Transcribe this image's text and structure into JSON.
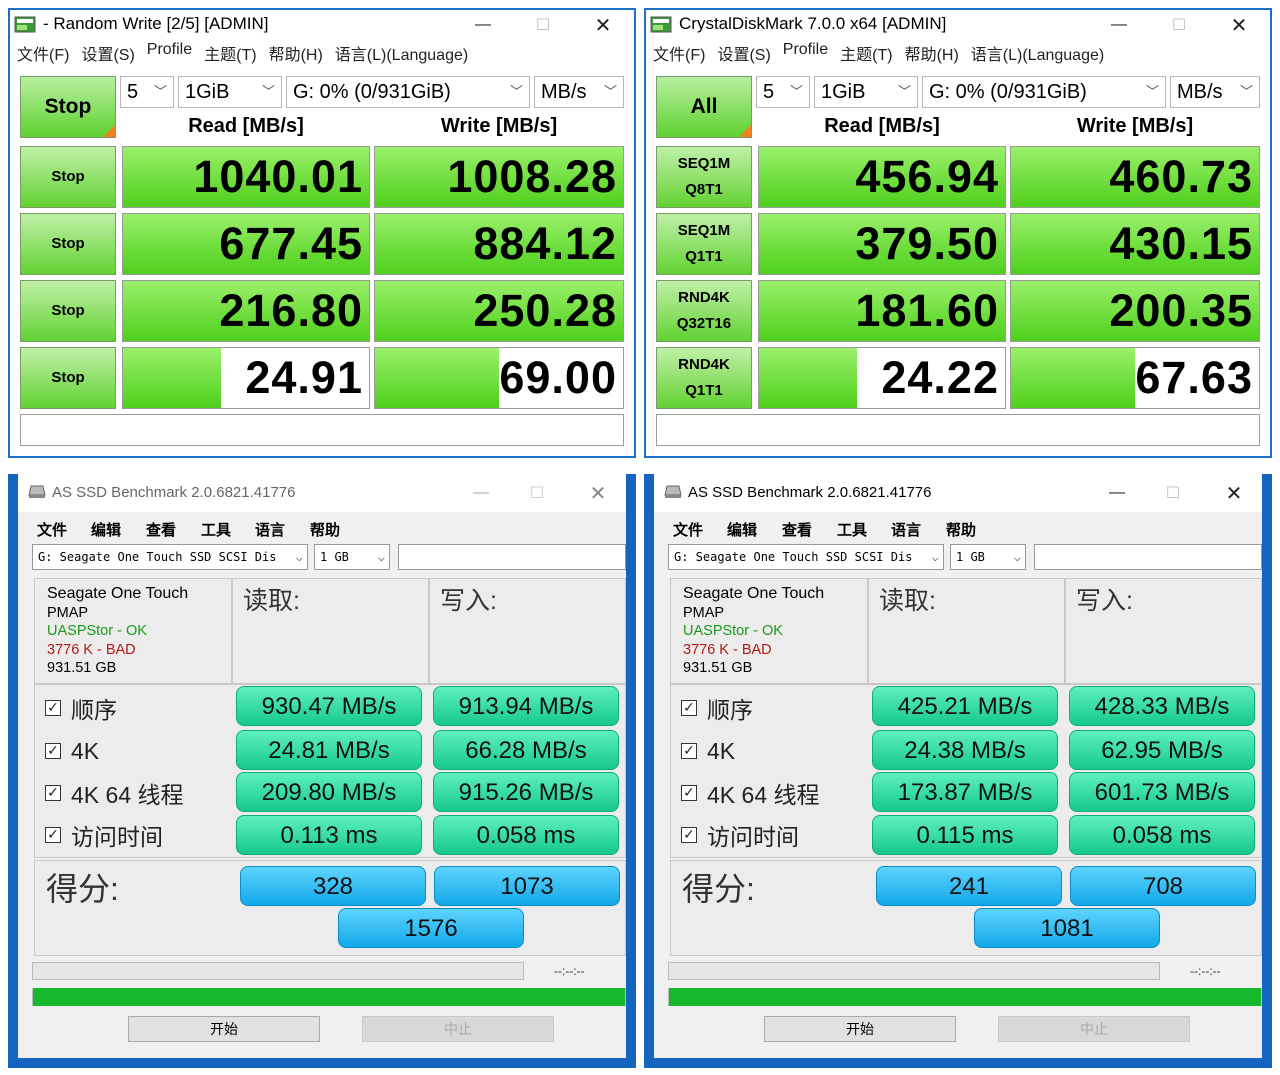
{
  "cdm_left": {
    "title": "- Random Write [2/5] [ADMIN]",
    "menu": [
      "文件(F)",
      "设置(S)",
      "Profile",
      "主题(T)",
      "帮助(H)",
      "语言(L)(Language)"
    ],
    "main_button": "Stop",
    "count": "5",
    "size": "1GiB",
    "drive": "G: 0% (0/931GiB)",
    "unit": "MB/s",
    "read_header": "Read [MB/s]",
    "write_header": "Write [MB/s]",
    "rows": [
      {
        "label1": "Stop",
        "label2": "",
        "read": "1040.01",
        "write": "1008.28",
        "read_frac": 1.0,
        "write_frac": 1.0
      },
      {
        "label1": "Stop",
        "label2": "",
        "read": "677.45",
        "write": "884.12",
        "read_frac": 1.0,
        "write_frac": 1.0
      },
      {
        "label1": "Stop",
        "label2": "",
        "read": "216.80",
        "write": "250.28",
        "read_frac": 1.0,
        "write_frac": 1.0
      },
      {
        "label1": "Stop",
        "label2": "",
        "read": "24.91",
        "write": "69.00",
        "read_frac": 0.4,
        "write_frac": 0.5
      }
    ]
  },
  "cdm_right": {
    "title": "CrystalDiskMark 7.0.0 x64 [ADMIN]",
    "menu": [
      "文件(F)",
      "设置(S)",
      "Profile",
      "主题(T)",
      "帮助(H)",
      "语言(L)(Language)"
    ],
    "main_button": "All",
    "count": "5",
    "size": "1GiB",
    "drive": "G: 0% (0/931GiB)",
    "unit": "MB/s",
    "read_header": "Read [MB/s]",
    "write_header": "Write [MB/s]",
    "rows": [
      {
        "label1": "SEQ1M",
        "label2": "Q8T1",
        "read": "456.94",
        "write": "460.73",
        "read_frac": 1.0,
        "write_frac": 1.0
      },
      {
        "label1": "SEQ1M",
        "label2": "Q1T1",
        "read": "379.50",
        "write": "430.15",
        "read_frac": 1.0,
        "write_frac": 1.0
      },
      {
        "label1": "RND4K",
        "label2": "Q32T16",
        "read": "181.60",
        "write": "200.35",
        "read_frac": 1.0,
        "write_frac": 1.0
      },
      {
        "label1": "RND4K",
        "label2": "Q1T1",
        "read": "24.22",
        "write": "67.63",
        "read_frac": 0.4,
        "write_frac": 0.5
      }
    ]
  },
  "as_left": {
    "title": "AS SSD Benchmark 2.0.6821.41776",
    "menu": [
      "文件",
      "编辑",
      "查看",
      "工具",
      "语言",
      "帮助"
    ],
    "drive": "G: Seagate One Touch SSD SCSI Dis",
    "size": "1 GB",
    "info": {
      "model": "Seagate One Touch",
      "fw": "PMAP",
      "driver": "UASPStor - OK",
      "align": "3776 K - BAD",
      "capacity": "931.51 GB"
    },
    "read_header": "读取:",
    "write_header": "写入:",
    "tests": [
      {
        "label": "顺序",
        "read": "930.47 MB/s",
        "write": "913.94 MB/s"
      },
      {
        "label": "4K",
        "read": "24.81 MB/s",
        "write": "66.28 MB/s"
      },
      {
        "label": "4K 64 线程",
        "read": "209.80 MB/s",
        "write": "915.26 MB/s"
      },
      {
        "label": "访问时间",
        "read": "0.113 ms",
        "write": "0.058 ms"
      }
    ],
    "score_label": "得分:",
    "score_read": "328",
    "score_write": "1073",
    "score_total": "1576",
    "time": "--:--:--",
    "progress": 1.0,
    "start": "开始",
    "abort": "中止"
  },
  "as_right": {
    "title": "AS SSD Benchmark 2.0.6821.41776",
    "menu": [
      "文件",
      "编辑",
      "查看",
      "工具",
      "语言",
      "帮助"
    ],
    "drive": "G: Seagate One Touch SSD SCSI Dis",
    "size": "1 GB",
    "info": {
      "model": "Seagate One Touch",
      "fw": "PMAP",
      "driver": "UASPStor - OK",
      "align": "3776 K - BAD",
      "capacity": "931.51 GB"
    },
    "read_header": "读取:",
    "write_header": "写入:",
    "tests": [
      {
        "label": "顺序",
        "read": "425.21 MB/s",
        "write": "428.33 MB/s"
      },
      {
        "label": "4K",
        "read": "24.38 MB/s",
        "write": "62.95 MB/s"
      },
      {
        "label": "4K 64 线程",
        "read": "173.87 MB/s",
        "write": "601.73 MB/s"
      },
      {
        "label": "访问时间",
        "read": "0.115 ms",
        "write": "0.058 ms"
      }
    ],
    "score_label": "得分:",
    "score_read": "241",
    "score_write": "708",
    "score_total": "1081",
    "time": "--:--:--",
    "progress": 1.0,
    "start": "开始",
    "abort": "中止"
  },
  "colors": {
    "cdm_green": "#5fd130",
    "as_teal": "#15c98a",
    "as_blue": "#12a8e8",
    "progress_green": "#16b82c",
    "window_border": "#1565c0",
    "ok_green": "#1a9a1a",
    "bad_red": "#b01818"
  }
}
